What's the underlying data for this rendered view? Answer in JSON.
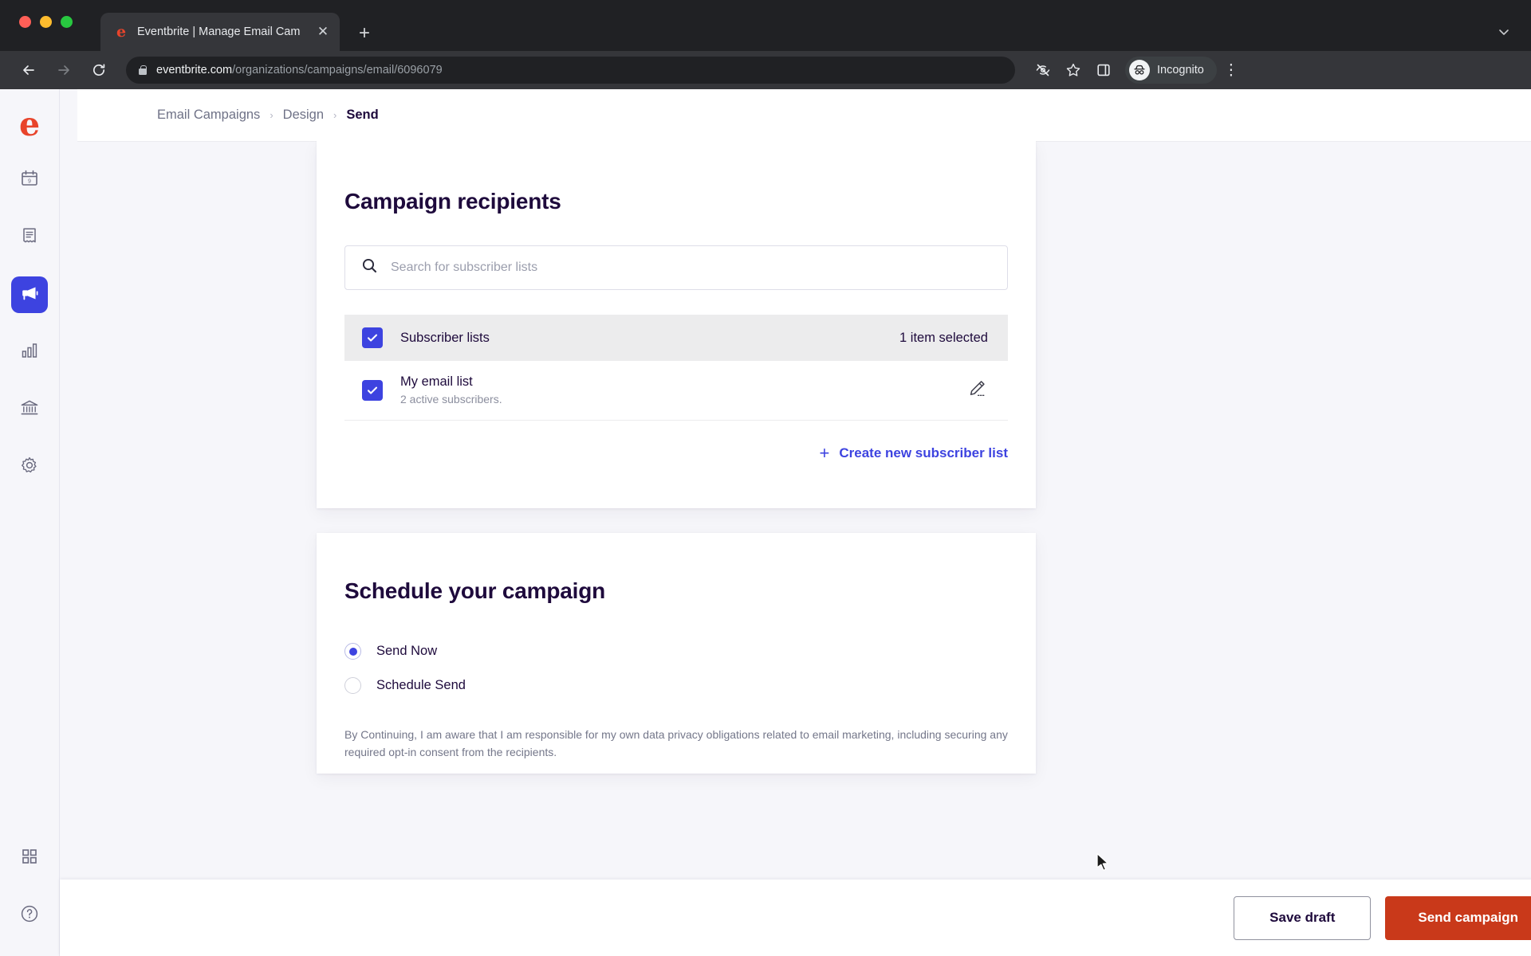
{
  "browser": {
    "tab": {
      "title": "Eventbrite | Manage Email Cam",
      "favicon": "eventbrite-e-icon",
      "close_label": "✕"
    },
    "new_tab_label": "+",
    "tabstrip_chevron": "⌄",
    "back_label": "←",
    "forward_label": "→",
    "reload_label": "↻",
    "url_host": "eventbrite.com",
    "url_path": "/organizations/campaigns/email/6096079",
    "profile_label": "Incognito",
    "kebab_label": "⋮"
  },
  "sidebar": {
    "logo": "eventbrite-logo",
    "items": [
      {
        "name": "events",
        "icon": "calendar-icon",
        "active": false
      },
      {
        "name": "orders",
        "icon": "receipt-icon",
        "active": false
      },
      {
        "name": "marketing",
        "icon": "megaphone-icon",
        "active": true
      },
      {
        "name": "reports",
        "icon": "bar-chart-icon",
        "active": false
      },
      {
        "name": "finance",
        "icon": "bank-icon",
        "active": false
      },
      {
        "name": "settings",
        "icon": "gear-icon",
        "active": false
      }
    ],
    "bottom_items": [
      {
        "name": "apps",
        "icon": "grid-icon"
      },
      {
        "name": "help",
        "icon": "help-circle-icon"
      }
    ]
  },
  "breadcrumb": {
    "items": [
      {
        "label": "Email Campaigns",
        "current": false
      },
      {
        "label": "Design",
        "current": false
      },
      {
        "label": "Send",
        "current": true
      }
    ],
    "separator": "›"
  },
  "recipients": {
    "title": "Campaign recipients",
    "search_placeholder": "Search for subscriber lists",
    "search_value": "",
    "search_icon": "search-icon",
    "list_header": {
      "label": "Subscriber lists",
      "count_text": "1 item selected",
      "checked": true
    },
    "rows": [
      {
        "name": "My email list",
        "subtitle": "2 active subscribers.",
        "checked": true,
        "edit_icon": "pencil-icon"
      }
    ],
    "create_link": {
      "label": "Create new subscriber list",
      "icon": "plus-icon"
    }
  },
  "schedule": {
    "title": "Schedule your campaign",
    "options": [
      {
        "label": "Send Now",
        "selected": true
      },
      {
        "label": "Schedule Send",
        "selected": false
      }
    ],
    "disclaimer": "By Continuing, I am aware that I am responsible for my own data privacy obligations related to email marketing, including securing any required opt-in consent from the recipients."
  },
  "footer": {
    "save_label": "Save draft",
    "send_label": "Send campaign"
  },
  "colors": {
    "accent_blue": "#3d43e0",
    "brand_red": "#e8442b",
    "primary_button": "#c9391a",
    "heading": "#1e0a3c",
    "page_bg": "#f6f6fa"
  }
}
